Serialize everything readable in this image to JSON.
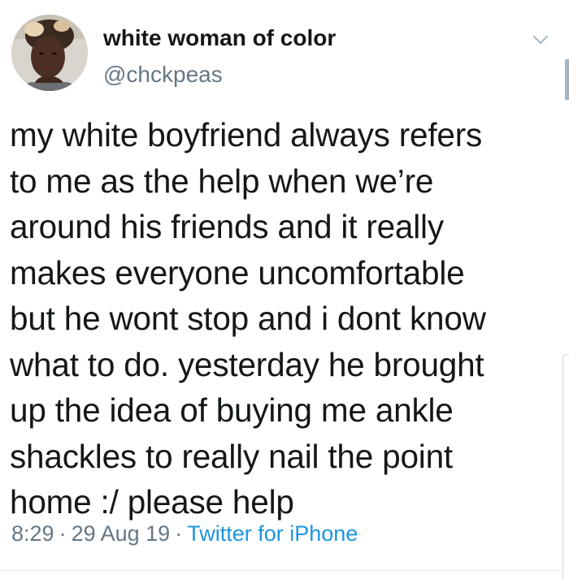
{
  "user": {
    "display_name": "white woman of color",
    "handle": "@chckpeas"
  },
  "tweet": {
    "lines": [
      "my white boyfriend always refers",
      "to me as the help when we’re",
      "around his friends and it really",
      "makes everyone uncomfortable",
      "but he wont stop and i dont know",
      "what to do. yesterday he brought",
      "up the idea of buying me ankle",
      "shackles to really nail the point",
      "home :/ please help"
    ],
    "time": "8:29",
    "date": "29 Aug 19",
    "separator": "·",
    "source": "Twitter for iPhone"
  },
  "icons": {
    "menu": "chevron-down-icon",
    "avatar": "profile-photo"
  },
  "colors": {
    "text": "#14171a",
    "muted": "#657786",
    "link": "#1b95e0"
  }
}
